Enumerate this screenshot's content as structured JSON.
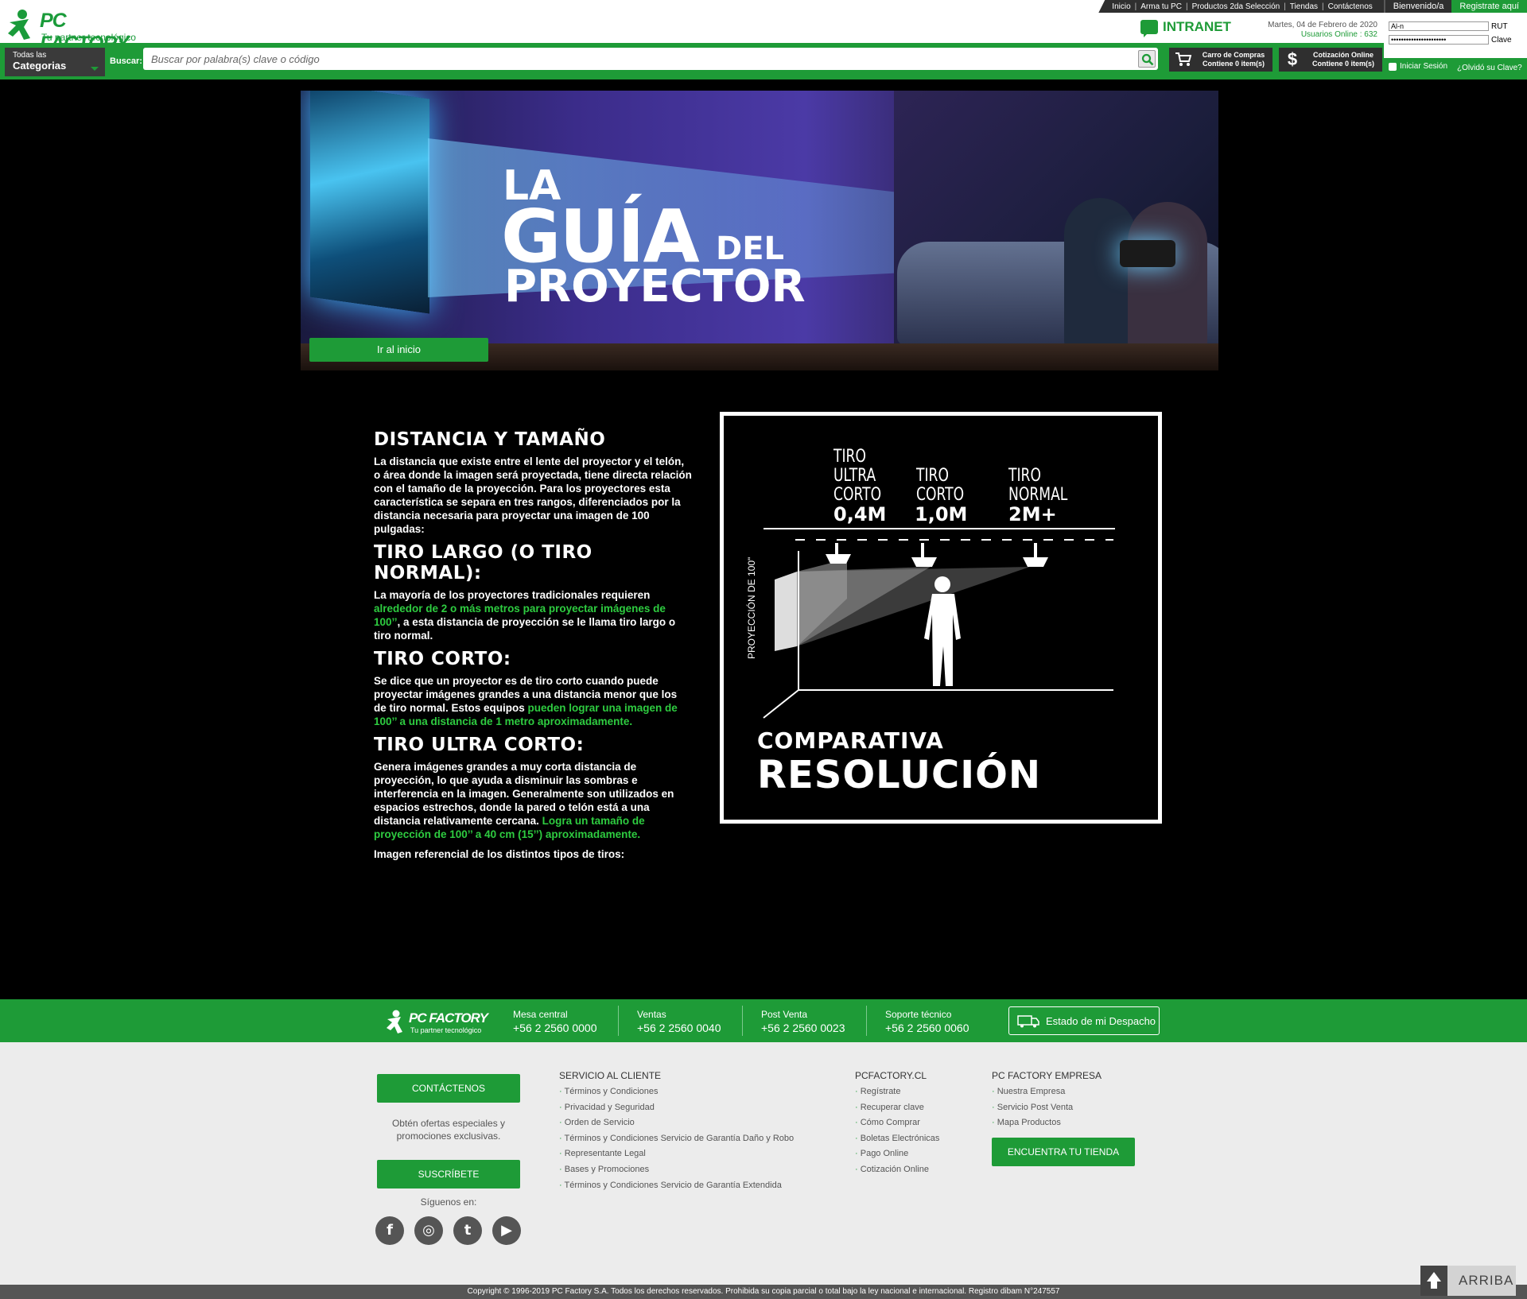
{
  "brand": {
    "name": "PC FACTORY",
    "tagline": "Tu partner tecnológico",
    "accent": "#1e9b37"
  },
  "topnav": {
    "links": [
      "Inicio",
      "Arma tu PC",
      "Productos 2da Selección",
      "Tiendas",
      "Contáctenos"
    ],
    "welcome": "Bienvenido/a",
    "register": "Registrate aquí"
  },
  "header": {
    "intranet": "INTRANET",
    "date": "Martes, 04 de Febrero de 2020",
    "online": "Usuarios Online : 632",
    "login": {
      "rut_value": "Al-n",
      "rut_label": "RUT",
      "clave_value": "••••••••••••••••••••••",
      "clave_label": "Clave",
      "signin": "Iniciar Sesión",
      "forgot": "¿Olvidó su Clave?"
    },
    "categories_small": "Todas las",
    "categories_big": "Categorias",
    "search_label": "Buscar:",
    "search_placeholder": "Buscar por palabra(s) clave o código",
    "cart_title": "Carro de Compras",
    "cart_count": "Contiene 0 item(s)",
    "quote_symbol": "$",
    "quote_title": "Cotización Online",
    "quote_count": "Contiene 0 item(s)"
  },
  "hero": {
    "line1": "LA",
    "line2": "GUÍA",
    "line3": "DEL",
    "line4": "PROYECTOR",
    "home_button": "Ir al inicio"
  },
  "article": {
    "h1": "DISTANCIA Y TAMAÑO",
    "p1": "La distancia que existe entre el lente del proyector y el telón, o área donde la imagen será proyectada, tiene directa relación con el tamaño de la proyección. Para los proyectores esta característica se separa en tres rangos, diferenciados por la distancia necesaria para proyectar una imagen de 100 pulgadas:",
    "h2": "TIRO LARGO (O TIRO NORMAL):",
    "p2a": "La mayoría de los proyectores tradicionales requieren ",
    "p2b": "alrededor de 2 o más metros para proyectar imágenes de 100’’",
    "p2c": ", a esta distancia de proyección se le llama tiro largo o tiro normal.",
    "h3": "TIRO CORTO:",
    "p3a": "Se dice que un proyector es de tiro corto cuando puede proyectar imágenes grandes a una distancia menor que los de tiro normal. Estos equipos ",
    "p3b": "pueden lograr una imagen de 100’’ a una distancia de 1 metro aproximadamente.",
    "h4": "TIRO ULTRA CORTO:",
    "p4a": "Genera imágenes grandes a muy corta distancia de proyección, lo que ayuda a disminuir las sombras e interferencia en la imagen. Generalmente son utilizados en espacios estrechos, donde la pared o telón está a una distancia relativamente cercana. ",
    "p4b": "Logra un tamaño de proyección de 100’’ a 40 cm (15’’) aproximadamente.",
    "p5": "Imagen referencial de los distintos tipos de tiros:"
  },
  "diagram": {
    "ultra_label": [
      "TIRO",
      "ULTRA",
      "CORTO"
    ],
    "ultra_value": "0,4M",
    "corto_label": [
      "TIRO",
      "CORTO"
    ],
    "corto_value": "1,0M",
    "normal_label": [
      "TIRO",
      "NORMAL"
    ],
    "normal_value": "2M+",
    "vertical": "PROYECCIÓN DE 100\"",
    "title1": "COMPARATIVA",
    "title2": "RESOLUCIÓN"
  },
  "footbar": {
    "contacts": [
      {
        "label": "Mesa central",
        "phone": "+56 2 2560 0000"
      },
      {
        "label": "Ventas",
        "phone": "+56 2 2560 0040"
      },
      {
        "label": "Post Venta",
        "phone": "+56 2 2560 0023"
      },
      {
        "label": "Soporte técnico",
        "phone": "+56 2 2560 0060"
      }
    ],
    "dispatch": "Estado de mi Despacho"
  },
  "footer": {
    "contact_button": "CONTÁCTENOS",
    "note": "Obtén ofertas especiales y promociones exclusivas.",
    "subscribe_button": "SUSCRÍBETE",
    "follow": "Síguenos en:",
    "social": [
      "f",
      "◎",
      "t",
      "▶"
    ],
    "col1": {
      "title": "SERVICIO AL CLIENTE",
      "items": [
        "Términos y Condiciones",
        "Privacidad y Seguridad",
        "Orden de Servicio",
        "Términos y Condiciones Servicio de Garantía Daño y Robo",
        "Representante Legal",
        "Bases y Promociones",
        "Términos y Condiciones Servicio de Garantía Extendida"
      ]
    },
    "col2": {
      "title": "PCFACTORY.CL",
      "items": [
        "Regístrate",
        "Recuperar clave",
        "Cómo Comprar",
        "Boletas Electrónicas",
        "Pago Online",
        "Cotización Online"
      ]
    },
    "col3": {
      "title": "PC FACTORY EMPRESA",
      "items": [
        "Nuestra Empresa",
        "Servicio Post Venta",
        "Mapa Productos"
      ]
    },
    "store_button": "ENCUENTRA TU TIENDA",
    "copyright": "Copyright © 1996-2019 PC Factory S.A. Todos los derechos reservados. Prohibida su copia parcial o total bajo la ley nacional e internacional. Registro dibam N°247557",
    "top_button": "ARRIBA"
  }
}
